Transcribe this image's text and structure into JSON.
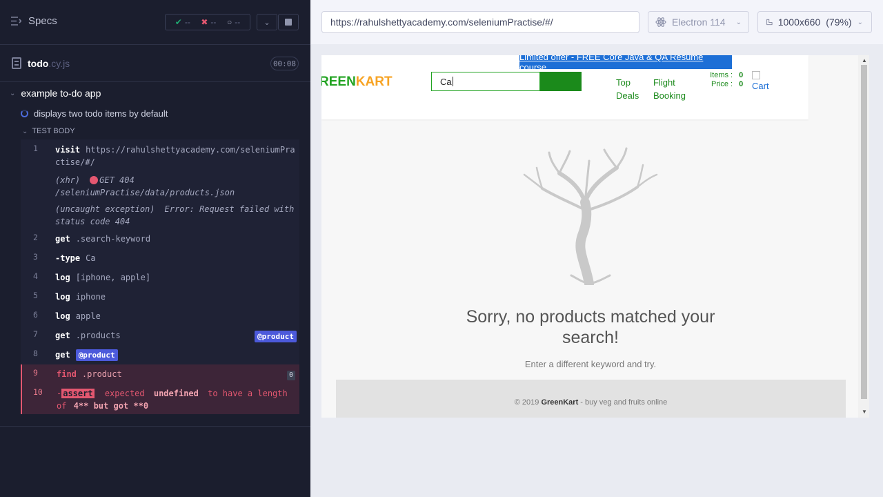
{
  "reporter": {
    "specs_label": "Specs",
    "stats": {
      "passed": "--",
      "failed": "--",
      "pending": "--"
    },
    "file": {
      "base": "todo",
      "ext": ".cy.js",
      "timer": "00:08"
    },
    "suite_title": "example to-do app",
    "test_title": "displays two todo items by default",
    "test_body_label": "TEST BODY",
    "commands": [
      {
        "num": "1",
        "method": "visit",
        "message": "https://rahulshettyacademy.com/seleniumPractise/#/"
      },
      {
        "num": "",
        "method": "(xhr)",
        "message": "GET 404 /seleniumPractise/data/products.json"
      },
      {
        "num": "",
        "method": "(uncaught exception)",
        "message": "Error: Request failed with status code 404"
      },
      {
        "num": "2",
        "method": "get",
        "message": ".search-keyword"
      },
      {
        "num": "3",
        "method": "-type",
        "message": "Ca"
      },
      {
        "num": "4",
        "method": "log",
        "message": "[iphone, apple]"
      },
      {
        "num": "5",
        "method": "log",
        "message": "iphone"
      },
      {
        "num": "6",
        "method": "log",
        "message": "apple"
      },
      {
        "num": "7",
        "method": "get",
        "message": ".products",
        "alias": "@product"
      },
      {
        "num": "8",
        "method": "get",
        "alias": "@product"
      },
      {
        "num": "9",
        "method": "find",
        "message": ".product",
        "count": "0"
      },
      {
        "num": "10",
        "method": "-assert",
        "assert_label": "assert",
        "expected_word": "expected",
        "undefined_word": "undefined",
        "message_mid": "to have a length of",
        "message_tail": "4** but got **0"
      }
    ]
  },
  "aut_header": {
    "url": "https://rahulshettyacademy.com/seleniumPractise/#/",
    "browser": "Electron 114",
    "viewport": "1000x660",
    "viewport_scale": "(79%)"
  },
  "greenkart": {
    "promo": "Limited offer - FREE Core Java & QA Resume course",
    "logo_green": "REEN",
    "logo_orange": "KART",
    "search_value": "Ca",
    "nav": {
      "top_deals_1": "Top",
      "top_deals_2": "Deals",
      "flight_1": "Flight",
      "flight_2": "Booking"
    },
    "cart": {
      "items_label": "Items",
      "items_value": "0",
      "price_label": "Price",
      "price_value": "0",
      "cart_label": "Cart"
    },
    "no_results": "Sorry, no products matched your search!",
    "hint": "Enter a different keyword and try.",
    "footer_prefix": "© 2019",
    "footer_brand": "GreenKart",
    "footer_suffix": "- buy veg and fruits online"
  },
  "colors": {
    "pass": "#1fa971",
    "fail": "#e45770",
    "accent": "#4c5adb",
    "green": "#22a322",
    "orange": "#f7a323"
  }
}
